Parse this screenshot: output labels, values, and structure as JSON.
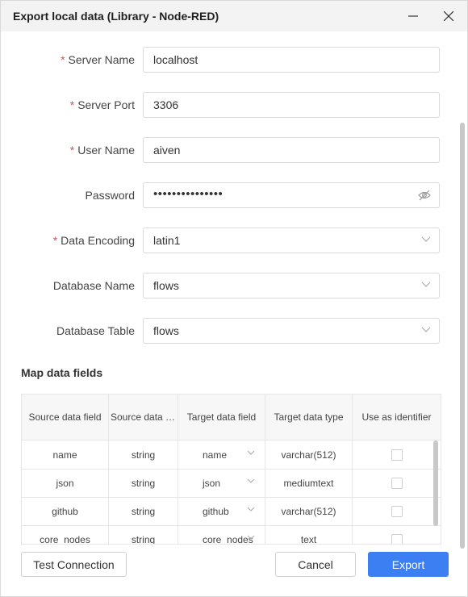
{
  "window": {
    "title": "Export local data (Library - Node-RED)"
  },
  "form": {
    "server_name": {
      "label": "Server Name",
      "value": "localhost",
      "required": true
    },
    "server_port": {
      "label": "Server Port",
      "value": "3306",
      "required": true
    },
    "user_name": {
      "label": "User Name",
      "value": "aiven",
      "required": true
    },
    "password": {
      "label": "Password",
      "value": "•••••••••••••••",
      "required": false,
      "icon": "eye-off-icon"
    },
    "data_encoding": {
      "label": "Data Encoding",
      "value": "latin1",
      "required": true
    },
    "database_name": {
      "label": "Database Name",
      "value": "flows",
      "required": false
    },
    "database_table": {
      "label": "Database Table",
      "value": "flows",
      "required": false
    },
    "required_mark": "*"
  },
  "mapping": {
    "title": "Map data fields",
    "columns": [
      "Source data field",
      "Source data ty...",
      "Target data field",
      "Target data type",
      "Use as identifier"
    ],
    "rows": [
      {
        "source": "name",
        "source_type": "string",
        "target": "name",
        "target_type": "varchar(512)",
        "identifier": false
      },
      {
        "source": "json",
        "source_type": "string",
        "target": "json",
        "target_type": "mediumtext",
        "identifier": false
      },
      {
        "source": "github",
        "source_type": "string",
        "target": "github",
        "target_type": "varchar(512)",
        "identifier": false
      },
      {
        "source": "core_nodes",
        "source_type": "string",
        "target": "core_nodes",
        "target_type": "text",
        "identifier": false
      }
    ]
  },
  "buttons": {
    "test": "Test Connection",
    "cancel": "Cancel",
    "export": "Export"
  },
  "colors": {
    "primary": "#3b7ff2",
    "required": "#e34d59",
    "titlebar": "#f3f3f3"
  }
}
